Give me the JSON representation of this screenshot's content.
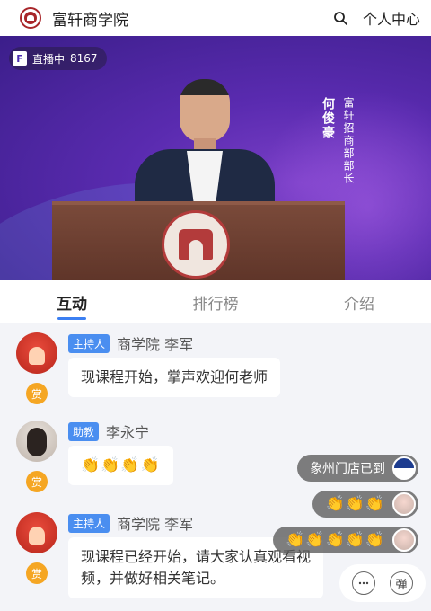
{
  "header": {
    "title": "富轩商学院",
    "profile_label": "个人中心"
  },
  "video": {
    "live_logo": "F",
    "live_status": "直播中",
    "live_viewers": "8167",
    "caption_name": "何俊豪",
    "caption_role": "富轩招商部部长"
  },
  "tabs": [
    {
      "label": "互动",
      "active": true
    },
    {
      "label": "排行榜",
      "active": false
    },
    {
      "label": "介绍",
      "active": false
    }
  ],
  "messages": [
    {
      "role": "主持人",
      "sender": "商学院 李军",
      "text": "现课程开始，掌声欢迎何老师",
      "reward": "赏"
    },
    {
      "role": "助教",
      "sender": "李永宁",
      "text": "👏👏👏👏",
      "reward": "赏"
    },
    {
      "role": "主持人",
      "sender": "商学院 李军",
      "text_line1": "现课程已经开始，请大家认真观看视",
      "text_line2": "频，并做好相关笔记。",
      "reward": "赏"
    }
  ],
  "toasts": [
    {
      "text": "象州门店已到"
    },
    {
      "text": "👏👏👏"
    },
    {
      "text": "👏👏👏👏👏"
    }
  ],
  "actions": {
    "comment_icon": "comment-icon",
    "danmaku_label": "弹"
  },
  "colors": {
    "accent": "#3b7ff2",
    "badge": "#4a8ef0",
    "reward": "#f5a623",
    "brand": "#a8262a"
  }
}
